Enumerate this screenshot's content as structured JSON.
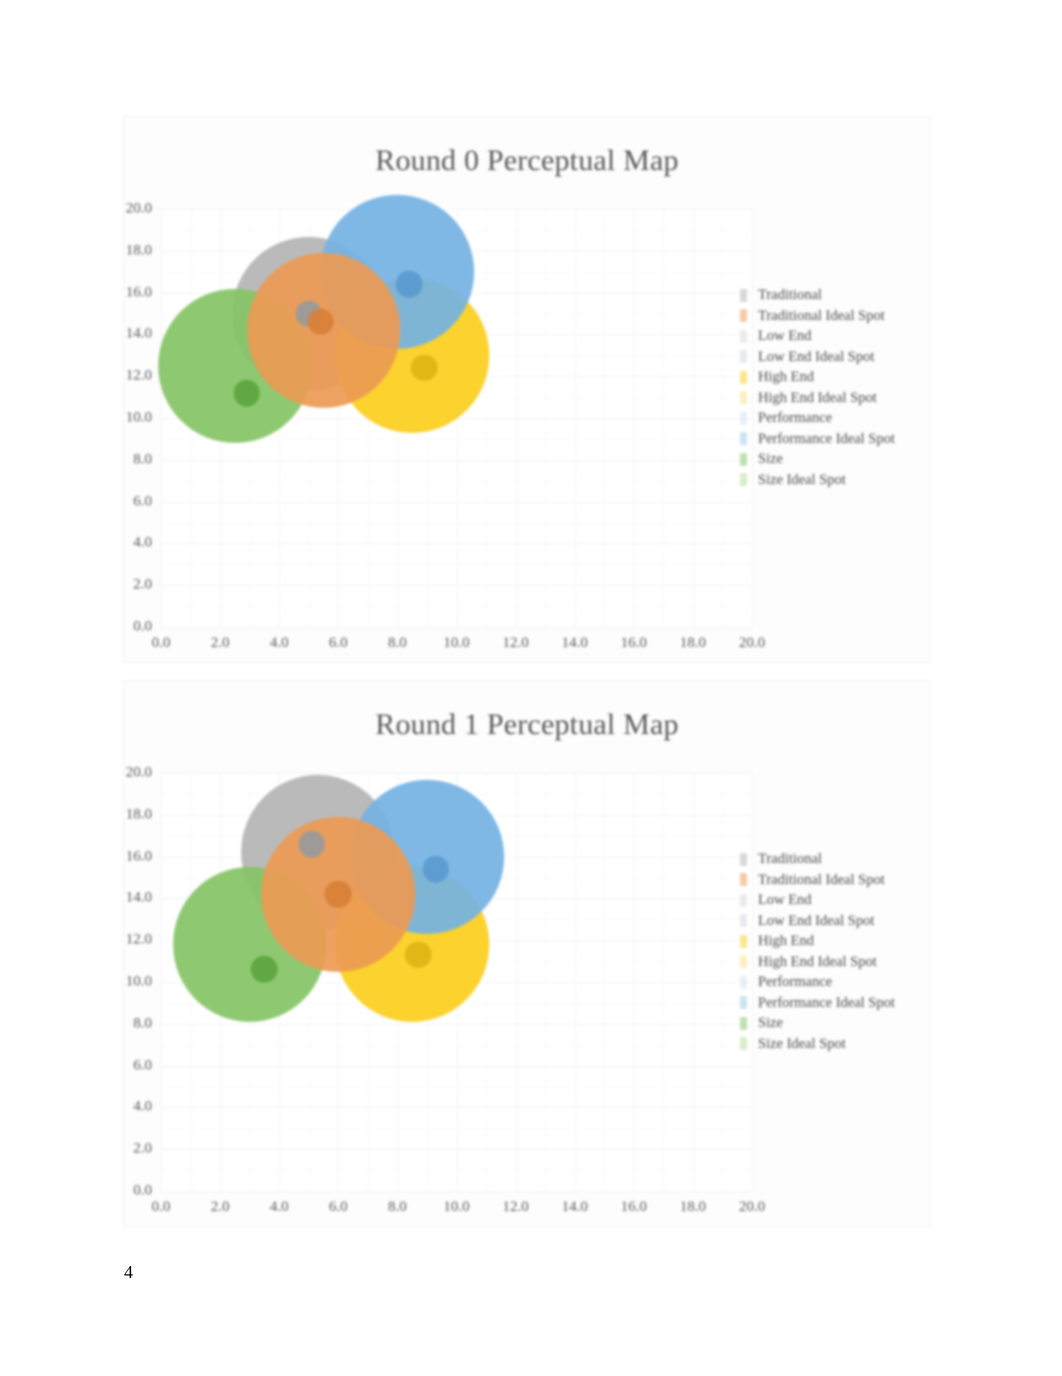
{
  "document": {
    "page_number": "4",
    "background_color": "#ffffff"
  },
  "palette": {
    "traditional": "#b4b4b4",
    "traditional_ideal": "#ec9a54",
    "low_end": "#84c466",
    "low_end_ideal": "#a8a8a8",
    "high_end": "#fbce1c",
    "high_end_ideal": "#f2c744",
    "performance": "#74b2e3",
    "performance_ideal": "#9ccbe8",
    "size": "#84c466",
    "size_ideal": "#9ad47c",
    "title_color": "#585858",
    "tick_color": "#585858",
    "grid_color": "#f4f4f4"
  },
  "legend": {
    "items": [
      {
        "label": "Traditional",
        "color": "#b4b4b4"
      },
      {
        "label": "Traditional Ideal Spot",
        "color": "#ec9a54"
      },
      {
        "label": "Low End",
        "color": "#d9d9d9"
      },
      {
        "label": "Low End Ideal Spot",
        "color": "#cfd8e0"
      },
      {
        "label": "High End",
        "color": "#fbce1c"
      },
      {
        "label": "High End Ideal Spot",
        "color": "#fbe08a"
      },
      {
        "label": "Performance",
        "color": "#cfe2f3"
      },
      {
        "label": "Performance Ideal Spot",
        "color": "#9ccbe8"
      },
      {
        "label": "Size",
        "color": "#84c466"
      },
      {
        "label": "Size Ideal Spot",
        "color": "#b6dc9a"
      }
    ]
  },
  "chart_data": [
    {
      "id": "round0",
      "type": "scatter",
      "title": "Round 0 Perceptual Map",
      "xlabel": "",
      "ylabel": "",
      "xlim": [
        0,
        20
      ],
      "ylim": [
        0,
        20
      ],
      "xticks": [
        "0.0",
        "2.0",
        "4.0",
        "6.0",
        "8.0",
        "10.0",
        "12.0",
        "14.0",
        "16.0",
        "18.0",
        "20.0"
      ],
      "yticks": [
        "0.0",
        "2.0",
        "4.0",
        "6.0",
        "8.0",
        "10.0",
        "12.0",
        "14.0",
        "16.0",
        "18.0",
        "20.0"
      ],
      "grid": true,
      "legend_position": "right",
      "series": [
        {
          "name": "Traditional",
          "x": 5.0,
          "y": 15.0,
          "r": 2.6,
          "color": "#b4b4b4"
        },
        {
          "name": "Traditional Ideal Spot",
          "x": 5.0,
          "y": 15.0,
          "r": 0.45,
          "color": "#9a9a9a"
        },
        {
          "name": "Low End",
          "x": 2.5,
          "y": 12.5,
          "r": 2.6,
          "color": "#84c466"
        },
        {
          "name": "Low End Ideal Spot",
          "x": 2.9,
          "y": 11.2,
          "r": 0.45,
          "color": "#5ea83f"
        },
        {
          "name": "High End",
          "x": 8.5,
          "y": 13.0,
          "r": 2.6,
          "color": "#fbce1c"
        },
        {
          "name": "High End Ideal Spot",
          "x": 8.9,
          "y": 12.4,
          "r": 0.45,
          "color": "#e0b415"
        },
        {
          "name": "Performance",
          "x": 8.0,
          "y": 17.0,
          "r": 2.6,
          "color": "#74b2e3"
        },
        {
          "name": "Performance Ideal Spot",
          "x": 8.4,
          "y": 16.4,
          "r": 0.45,
          "color": "#5c9bd0"
        },
        {
          "name": "Size",
          "x": 5.5,
          "y": 14.2,
          "r": 2.6,
          "color": "#ec9a54"
        },
        {
          "name": "Size Ideal Spot",
          "x": 5.4,
          "y": 14.6,
          "r": 0.45,
          "color": "#d97f38"
        }
      ]
    },
    {
      "id": "round1",
      "type": "scatter",
      "title": "Round 1 Perceptual Map",
      "xlabel": "",
      "ylabel": "",
      "xlim": [
        0,
        20
      ],
      "ylim": [
        0,
        20
      ],
      "xticks": [
        "0.0",
        "2.0",
        "4.0",
        "6.0",
        "8.0",
        "10.0",
        "12.0",
        "14.0",
        "16.0",
        "18.0",
        "20.0"
      ],
      "yticks": [
        "0.0",
        "2.0",
        "4.0",
        "6.0",
        "8.0",
        "10.0",
        "12.0",
        "14.0",
        "16.0",
        "18.0",
        "20.0"
      ],
      "grid": true,
      "legend_position": "right",
      "series": [
        {
          "name": "Traditional",
          "x": 5.3,
          "y": 16.2,
          "r": 2.6,
          "color": "#b4b4b4"
        },
        {
          "name": "Traditional Ideal Spot",
          "x": 5.1,
          "y": 16.6,
          "r": 0.45,
          "color": "#9a9a9a"
        },
        {
          "name": "Low End",
          "x": 3.0,
          "y": 11.8,
          "r": 2.6,
          "color": "#84c466"
        },
        {
          "name": "Low End Ideal Spot",
          "x": 3.5,
          "y": 10.6,
          "r": 0.45,
          "color": "#5ea83f"
        },
        {
          "name": "High End",
          "x": 8.5,
          "y": 11.8,
          "r": 2.6,
          "color": "#fbce1c"
        },
        {
          "name": "High End Ideal Spot",
          "x": 8.7,
          "y": 11.3,
          "r": 0.45,
          "color": "#e0b415"
        },
        {
          "name": "Performance",
          "x": 9.0,
          "y": 16.0,
          "r": 2.6,
          "color": "#74b2e3"
        },
        {
          "name": "Performance Ideal Spot",
          "x": 9.3,
          "y": 15.4,
          "r": 0.45,
          "color": "#5c9bd0"
        },
        {
          "name": "Size",
          "x": 6.0,
          "y": 14.2,
          "r": 2.6,
          "color": "#ec9a54"
        },
        {
          "name": "Size Ideal Spot",
          "x": 6.0,
          "y": 14.2,
          "r": 0.45,
          "color": "#d97f38"
        }
      ]
    }
  ]
}
